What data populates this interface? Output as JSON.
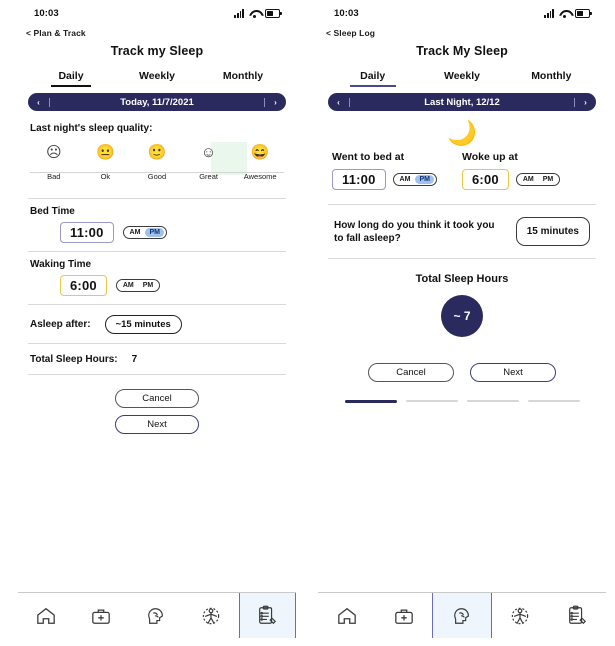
{
  "colors": {
    "navy": "#2b2a5e",
    "accent_blue": "#9fc1ee",
    "highlight_green": "#e9f7ec",
    "active_nav_bg": "#eef5fd",
    "amber_border": "#e9c84a",
    "lavender_border": "#9a9ac4"
  },
  "left_phone": {
    "status": {
      "time": "10:03",
      "signal_icon": "signal-bars-icon",
      "wifi_icon": "wifi-icon",
      "battery_icon": "battery-icon"
    },
    "back_link": "< Plan & Track",
    "title": "Track my Sleep",
    "tabs": [
      {
        "label": "Daily",
        "active": true
      },
      {
        "label": "Weekly",
        "active": false
      },
      {
        "label": "Monthly",
        "active": false
      }
    ],
    "date_bar": {
      "prev": "‹",
      "label": "Today, 11/7/2021",
      "next": "›"
    },
    "quality": {
      "label": "Last night's sleep quality:",
      "options": [
        {
          "emoji": "☹",
          "label": "Bad",
          "selected": false
        },
        {
          "emoji": "😐",
          "label": "Ok",
          "selected": false
        },
        {
          "emoji": "🙂",
          "label": "Good",
          "selected": false
        },
        {
          "emoji": "☺",
          "label": "Great",
          "selected": true
        },
        {
          "emoji": "😄",
          "label": "Awesome",
          "selected": false
        }
      ]
    },
    "bed_time": {
      "label": "Bed Time",
      "value": "11:00",
      "am": "AM",
      "pm": "PM",
      "selected": "PM"
    },
    "waking_time": {
      "label": "Waking Time",
      "value": "6:00",
      "am": "AM",
      "pm": "PM",
      "selected": "AM"
    },
    "asleep_after": {
      "label": "Asleep after:",
      "value": "~15 minutes"
    },
    "total_sleep": {
      "label": "Total Sleep Hours:",
      "value": "7"
    },
    "buttons": {
      "cancel": "Cancel",
      "next": "Next"
    },
    "nav": [
      {
        "icon": "home-icon",
        "active": false
      },
      {
        "icon": "medical-kit-icon",
        "active": false
      },
      {
        "icon": "brain-head-icon",
        "active": false
      },
      {
        "icon": "body-anatomy-icon",
        "active": false
      },
      {
        "icon": "clipboard-pencil-icon",
        "active": true
      }
    ]
  },
  "right_phone": {
    "status": {
      "time": "10:03",
      "signal_icon": "signal-bars-icon",
      "wifi_icon": "wifi-icon",
      "battery_icon": "battery-icon"
    },
    "back_link": "< Sleep Log",
    "title": "Track My Sleep",
    "tabs": [
      {
        "label": "Daily",
        "active": true
      },
      {
        "label": "Weekly",
        "active": false
      },
      {
        "label": "Monthly",
        "active": false
      }
    ],
    "date_bar": {
      "prev": "‹",
      "label": "Last Night, 12/12",
      "next": "›"
    },
    "moon_icon": "sleeping-moon-icon",
    "bed_time": {
      "label": "Went to bed at",
      "value": "11:00",
      "am": "AM",
      "pm": "PM",
      "selected": "PM"
    },
    "wake_time": {
      "label": "Woke up at",
      "value": "6:00",
      "am": "AM",
      "pm": "PM",
      "selected": "AM"
    },
    "fall_asleep": {
      "question": "How long do you think it took you to fall asleep?",
      "value": "15 minutes"
    },
    "total_sleep": {
      "label": "Total Sleep Hours",
      "value": "~ 7"
    },
    "buttons": {
      "cancel": "Cancel",
      "next": "Next"
    },
    "progress": {
      "steps": 4,
      "current": 1
    },
    "nav": [
      {
        "icon": "home-icon",
        "active": false
      },
      {
        "icon": "medical-kit-icon",
        "active": false
      },
      {
        "icon": "brain-head-icon",
        "active": true
      },
      {
        "icon": "body-anatomy-icon",
        "active": false
      },
      {
        "icon": "clipboard-pencil-icon",
        "active": false
      }
    ]
  }
}
